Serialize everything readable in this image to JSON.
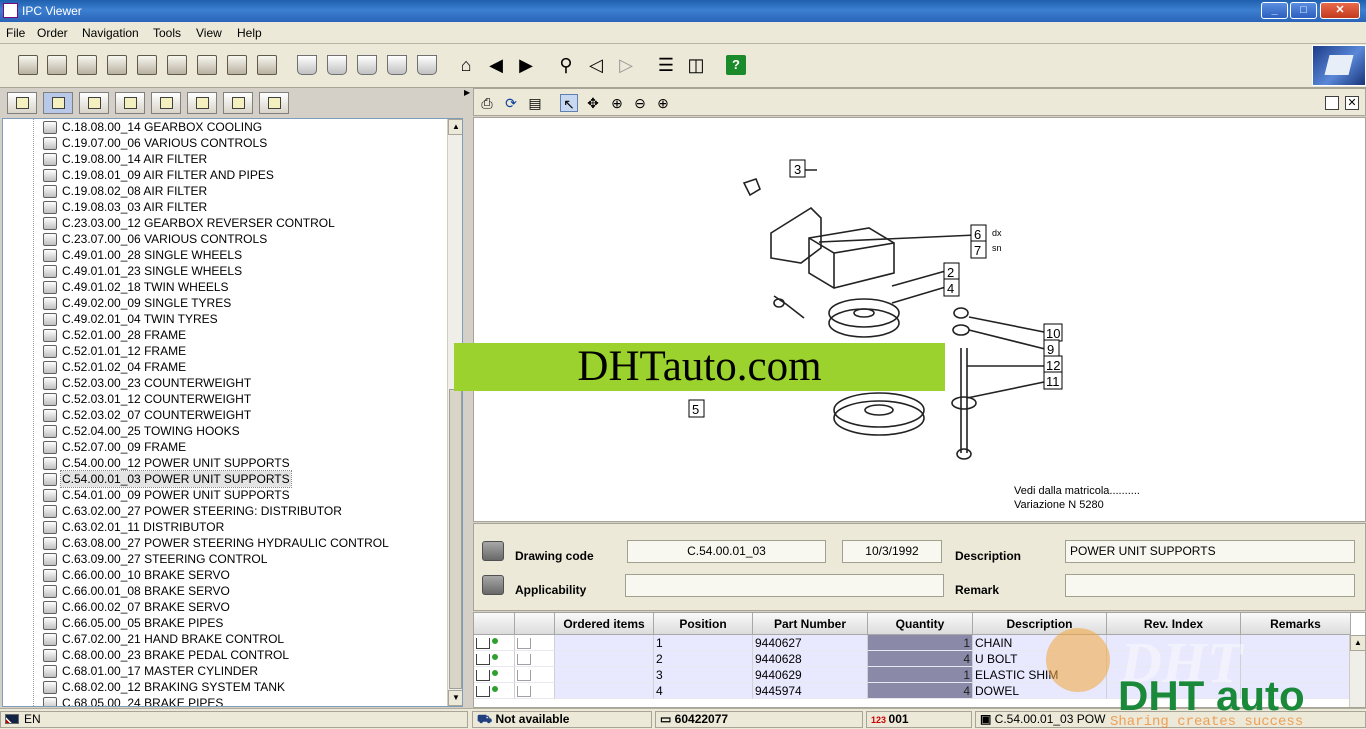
{
  "window": {
    "title": "IPC Viewer",
    "min": "_",
    "max": "□",
    "close": "✕"
  },
  "menu": [
    "File",
    "Order",
    "Navigation",
    "Tools",
    "View",
    "Help"
  ],
  "toolbar_icons": [
    "open-book-icon",
    "open-icon",
    "save-icon",
    "delete-icon",
    "export-icon",
    "import-icon",
    "refresh-icon",
    "print-icon",
    "settings-icon",
    "cart-add-icon",
    "cart-icon",
    "cart-up-icon",
    "cart-down-icon",
    "cart-send-icon",
    "home-icon",
    "first-icon",
    "last-icon",
    "search-icon",
    "back-icon",
    "forward-icon",
    "horizontal-split-icon",
    "vertical-split-icon",
    "help-icon"
  ],
  "tree": {
    "items": [
      "C.18.08.00_14 GEARBOX COOLING",
      "C.19.07.00_06 VARIOUS CONTROLS",
      "C.19.08.00_14 AIR FILTER",
      "C.19.08.01_09 AIR FILTER AND PIPES",
      "C.19.08.02_08 AIR FILTER",
      "C.19.08.03_03 AIR FILTER",
      "C.23.03.00_12 GEARBOX REVERSER  CONTROL",
      "C.23.07.00_06 VARIOUS CONTROLS",
      "C.49.01.00_28 SINGLE WHEELS",
      "C.49.01.01_23 SINGLE WHEELS",
      "C.49.01.02_18 TWIN WHEELS",
      "C.49.02.00_09 SINGLE TYRES",
      "C.49.02.01_04 TWIN TYRES",
      "C.52.01.00_28 FRAME",
      "C.52.01.01_12 FRAME",
      "C.52.01.02_04 FRAME",
      "C.52.03.00_23 COUNTERWEIGHT",
      "C.52.03.01_12 COUNTERWEIGHT",
      "C.52.03.02_07 COUNTERWEIGHT",
      "C.52.04.00_25 TOWING HOOKS",
      "C.52.07.00_09 FRAME",
      "C.54.00.00_12 POWER UNIT SUPPORTS",
      "C.54.00.01_03 POWER UNIT SUPPORTS",
      "C.54.01.00_09 POWER UNIT SUPPORTS",
      "C.63.02.00_27 POWER STEERING: DISTRIBUTOR",
      "C.63.02.01_11 DISTRIBUTOR",
      "C.63.08.00_27 POWER STEERING HYDRAULIC CONTROL",
      "C.63.09.00_27 STEERING CONTROL",
      "C.66.00.00_10 BRAKE SERVO",
      "C.66.00.01_08 BRAKE SERVO",
      "C.66.00.02_07 BRAKE SERVO",
      "C.66.05.00_05 BRAKE PIPES",
      "C.67.02.00_21 HAND BRAKE CONTROL",
      "C.68.00.00_23 BRAKE PEDAL CONTROL",
      "C.68.01.00_17 MASTER CYLINDER",
      "C.68.02.00_12 BRAKING SYSTEM TANK",
      "C.68.05.00_24 BRAKE PIPES"
    ],
    "selected_index": 22
  },
  "drawing": {
    "callouts": [
      "3",
      "6",
      "7",
      "2",
      "4",
      "10",
      "9",
      "12",
      "11",
      "5"
    ],
    "side_marks": [
      "dx",
      "sn"
    ],
    "note_line1": "Vedi dalla matricola..........",
    "note_line2": "Variazione N 5280"
  },
  "watermark": "DHTauto.com",
  "info": {
    "drawing_code_label": "Drawing code",
    "drawing_code": "C.54.00.01_03",
    "date": "10/3/1992",
    "description_label": "Description",
    "description": "POWER UNIT SUPPORTS",
    "applicability_label": "Applicability",
    "applicability": "",
    "remark_label": "Remark",
    "remark": ""
  },
  "grid": {
    "headers": [
      "Ordered items",
      "Position",
      "Part Number",
      "Quantity",
      "Description",
      "Rev. Index",
      "Remarks"
    ],
    "rows": [
      {
        "position": "1",
        "part": "9440627",
        "qty": "1",
        "desc": "CHAIN"
      },
      {
        "position": "2",
        "part": "9440628",
        "qty": "4",
        "desc": "U BOLT"
      },
      {
        "position": "3",
        "part": "9440629",
        "qty": "1",
        "desc": "ELASTIC SHIM"
      },
      {
        "position": "4",
        "part": "9445974",
        "qty": "4",
        "desc": "DOWEL"
      }
    ]
  },
  "status": {
    "language": "EN",
    "availability": "Not available",
    "code": "60422077",
    "num": "001",
    "current": "C.54.00.01_03 POW"
  },
  "brand": {
    "main": "DHT auto",
    "tagline": "Sharing creates success"
  },
  "colors": {
    "watermark_bg": "#9bd22d",
    "title_blue": "#2a64b8",
    "qty_col": "#8a8aa8",
    "row_hi": "#e8e8ff"
  }
}
